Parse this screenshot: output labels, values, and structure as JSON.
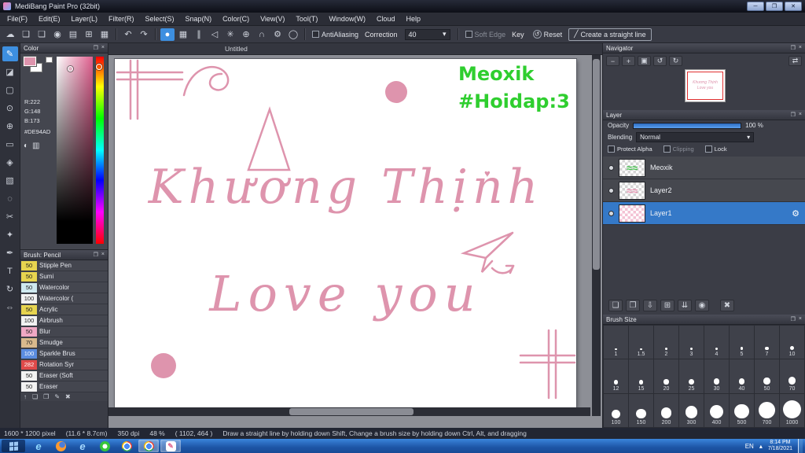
{
  "colors": {
    "pink": "#DE94AD",
    "green": "#2FCE2F",
    "accent": "#3D8FE0",
    "selection": "#3579C8"
  },
  "window": {
    "title": "MediBang Paint Pro (32bit)",
    "minimize_glyph": "─",
    "maximize_glyph": "❐",
    "close_glyph": "✕"
  },
  "menubar": [
    "File(F)",
    "Edit(E)",
    "Layer(L)",
    "Filter(R)",
    "Select(S)",
    "Snap(N)",
    "Color(C)",
    "View(V)",
    "Tool(T)",
    "Window(W)",
    "Cloud",
    "Help"
  ],
  "toolbar": {
    "file_icons": [
      {
        "name": "cloud-icon",
        "glyph": "☁"
      },
      {
        "name": "save-icon",
        "glyph": "❑"
      },
      {
        "name": "comment-icon",
        "glyph": "❏"
      },
      {
        "name": "palette-icon",
        "glyph": "◉"
      },
      {
        "name": "list-icon",
        "glyph": "▤"
      },
      {
        "name": "grid-icon",
        "glyph": "⊞"
      },
      {
        "name": "materials-icon",
        "glyph": "▦"
      }
    ],
    "undo_glyph": "↶",
    "redo_glyph": "↷",
    "snap_icons": [
      {
        "name": "round-brush-icon",
        "glyph": "●",
        "selected": true
      },
      {
        "name": "snap-grid-icon",
        "glyph": "▦"
      },
      {
        "name": "snap-parallel-icon",
        "glyph": "∥"
      },
      {
        "name": "snap-perspective-icon",
        "glyph": "◁"
      },
      {
        "name": "snap-radial-icon",
        "glyph": "✳"
      },
      {
        "name": "snap-cross-icon",
        "glyph": "⊕"
      },
      {
        "name": "snap-curve-icon",
        "glyph": "∩"
      },
      {
        "name": "snap-settings-icon",
        "glyph": "⚙"
      },
      {
        "name": "snap-ellipse-icon",
        "glyph": "◯"
      }
    ],
    "antialiasing_label": "AntiAliasing",
    "correction_label": "Correction",
    "correction_value": "40",
    "dropdown_caret": "▾",
    "soft_edge_label": "Soft Edge",
    "key_label": "Key",
    "reset_icon": "↺",
    "reset_label": "Reset",
    "straight_line_check": "╱",
    "straight_line_label": "Create a straight line"
  },
  "tools": [
    {
      "name": "pen-tool",
      "glyph": "✎",
      "selected": true
    },
    {
      "name": "eraser-tool",
      "glyph": "◪"
    },
    {
      "name": "select-tool",
      "glyph": "▢"
    },
    {
      "name": "eyedropper-tool",
      "glyph": "⊙"
    },
    {
      "name": "move-tool",
      "glyph": "⊕"
    },
    {
      "name": "shape-brush-tool",
      "glyph": "▭"
    },
    {
      "name": "bucket-tool",
      "glyph": "◈"
    },
    {
      "name": "gradient-tool",
      "glyph": "▧"
    },
    {
      "name": "ellipse-select-tool",
      "glyph": "◌"
    },
    {
      "name": "lasso-tool",
      "glyph": "✂"
    },
    {
      "name": "wand-tool",
      "glyph": "✦"
    },
    {
      "name": "path-tool",
      "glyph": "✒"
    },
    {
      "name": "text-tool",
      "glyph": "T"
    },
    {
      "name": "rotate-tool",
      "glyph": "↻"
    },
    {
      "name": "hand-tool",
      "glyph": "⇔"
    }
  ],
  "color_panel": {
    "title": "Color",
    "popout_glyph": "❐",
    "close_glyph": "×",
    "r_label": "R:222",
    "g_label": "G:148",
    "b_label": "B:173",
    "hex_label": "#DE94AD",
    "wheel_icon": "◐",
    "sliders_icon": "▥"
  },
  "brush_panel": {
    "title": "Brush: Pencil",
    "popout_glyph": "❐",
    "close_glyph": "×",
    "brushes": [
      {
        "size": "50",
        "name": "Stipple Pen",
        "badge": "#E7D44F",
        "fg": "#222222"
      },
      {
        "size": "50",
        "name": "Sumi",
        "badge": "#E7D44F",
        "fg": "#222222"
      },
      {
        "size": "50",
        "name": "Watercolor",
        "badge": "#CFE9EF",
        "fg": "#222222"
      },
      {
        "size": "100",
        "name": "Watercolor (",
        "badge": "#F2F2F2",
        "fg": "#222222"
      },
      {
        "size": "50",
        "name": "Acrylic",
        "badge": "#E7D44F",
        "fg": "#222222"
      },
      {
        "size": "100",
        "name": "Airbrush",
        "badge": "#F2F2F2",
        "fg": "#222222"
      },
      {
        "size": "50",
        "name": "Blur",
        "badge": "#F0A8C4",
        "fg": "#222222"
      },
      {
        "size": "70",
        "name": "Smudge",
        "badge": "#D9B98C",
        "fg": "#222222"
      },
      {
        "size": "100",
        "name": "Sparkle Brus",
        "badge": "#5B8DE0",
        "fg": "#ffffff"
      },
      {
        "size": "282",
        "name": "Rotation Syr",
        "badge": "#E04A4A",
        "fg": "#ffffff"
      },
      {
        "size": "50",
        "name": "Eraser (Soft",
        "badge": "#F2F2F2",
        "fg": "#222222"
      },
      {
        "size": "50",
        "name": "Eraser",
        "badge": "#F2F2F2",
        "fg": "#222222"
      }
    ],
    "footer_icons": [
      {
        "name": "brush-up-icon",
        "glyph": "↑"
      },
      {
        "name": "brush-new-icon",
        "glyph": "❏"
      },
      {
        "name": "brush-duplicate-icon",
        "glyph": "❐"
      },
      {
        "name": "brush-edit-icon",
        "glyph": "✎"
      },
      {
        "name": "brush-delete-icon",
        "glyph": "✖"
      }
    ]
  },
  "canvas": {
    "tab_title": "Untitled",
    "green_line1": "Meoxik",
    "green_line2": "#Hoidap:3",
    "script_line1": "Khương Thịnh",
    "script_line2": "Love you",
    "heart": "♥"
  },
  "navigator": {
    "title": "Navigator",
    "popout_glyph": "❐",
    "close_glyph": "×",
    "buttons": [
      {
        "name": "zoom-out-icon",
        "glyph": "−"
      },
      {
        "name": "zoom-in-icon",
        "glyph": "+"
      },
      {
        "name": "zoom-fit-icon",
        "glyph": "▣"
      },
      {
        "name": "rotate-left-icon",
        "glyph": "↺"
      },
      {
        "name": "rotate-right-icon",
        "glyph": "↻"
      },
      {
        "name": "flip-icon",
        "glyph": "⇄"
      }
    ]
  },
  "layer_panel": {
    "title": "Layer",
    "popout_glyph": "❐",
    "close_glyph": "×",
    "opacity_label": "Opacity",
    "opacity_value": "100 %",
    "blending_label": "Blending",
    "blending_value": "Normal",
    "dropdown_caret": "▾",
    "protect_alpha_label": "Protect Alpha",
    "clipping_label": "Clipping",
    "lock_label": "Lock",
    "layers": [
      {
        "name": "Meoxik",
        "thumb": "green",
        "scribble": "≈≈",
        "gear": ""
      },
      {
        "name": "Layer2",
        "thumb": "pink",
        "scribble": "≈≈",
        "gear": ""
      },
      {
        "name": "Layer1",
        "thumb": "plain",
        "scribble": "",
        "gear": "⚙",
        "selected": true
      }
    ],
    "footer_icons": [
      {
        "name": "add-layer-icon",
        "glyph": "❏"
      },
      {
        "name": "duplicate-layer-icon",
        "glyph": "❐"
      },
      {
        "name": "transfer-layer-icon",
        "glyph": "⇩"
      },
      {
        "name": "add-folder-icon",
        "glyph": "⊞"
      },
      {
        "name": "merge-layer-icon",
        "glyph": "⇊"
      },
      {
        "name": "camera-icon",
        "glyph": "◉"
      },
      {
        "name": "delete-layer-icon",
        "glyph": "✖"
      }
    ]
  },
  "brush_size_panel": {
    "title": "Brush Size",
    "popout_glyph": "❐",
    "close_glyph": "×",
    "sizes": [
      "1",
      "1.5",
      "2",
      "3",
      "4",
      "5",
      "7",
      "10",
      "12",
      "15",
      "20",
      "25",
      "30",
      "40",
      "50",
      "70",
      "100",
      "150",
      "200",
      "300",
      "400",
      "500",
      "700",
      "1000"
    ]
  },
  "statusbar": {
    "size": "1600 * 1200 pixel",
    "dimensions": "(11.6 * 8.7cm)",
    "dpi": "350 dpi",
    "zoom": "48 %",
    "cursor": "( 1102, 464 )",
    "hint": "Draw a straight line by holding down Shift, Change a brush size by holding down Ctrl, Alt, and dragging"
  },
  "taskbar": {
    "icons": [
      {
        "name": "edge-icon",
        "style": "edge",
        "label": "e"
      },
      {
        "name": "firefox-icon",
        "style": "firefox",
        "label": ""
      },
      {
        "name": "ie-icon",
        "style": "ie",
        "label": "e"
      },
      {
        "name": "line-app-icon",
        "style": "green",
        "label": ""
      },
      {
        "name": "chrome-icon",
        "style": "chrome",
        "label": ""
      },
      {
        "name": "chrome-2-icon",
        "style": "chrome",
        "label": "",
        "active": true
      },
      {
        "name": "medibang-taskbar-icon",
        "style": "medibang",
        "label": "✎",
        "active": true
      }
    ],
    "language": "EN",
    "tray_arrow": "▴",
    "time": "8:14 PM",
    "date": "7/18/2021"
  }
}
